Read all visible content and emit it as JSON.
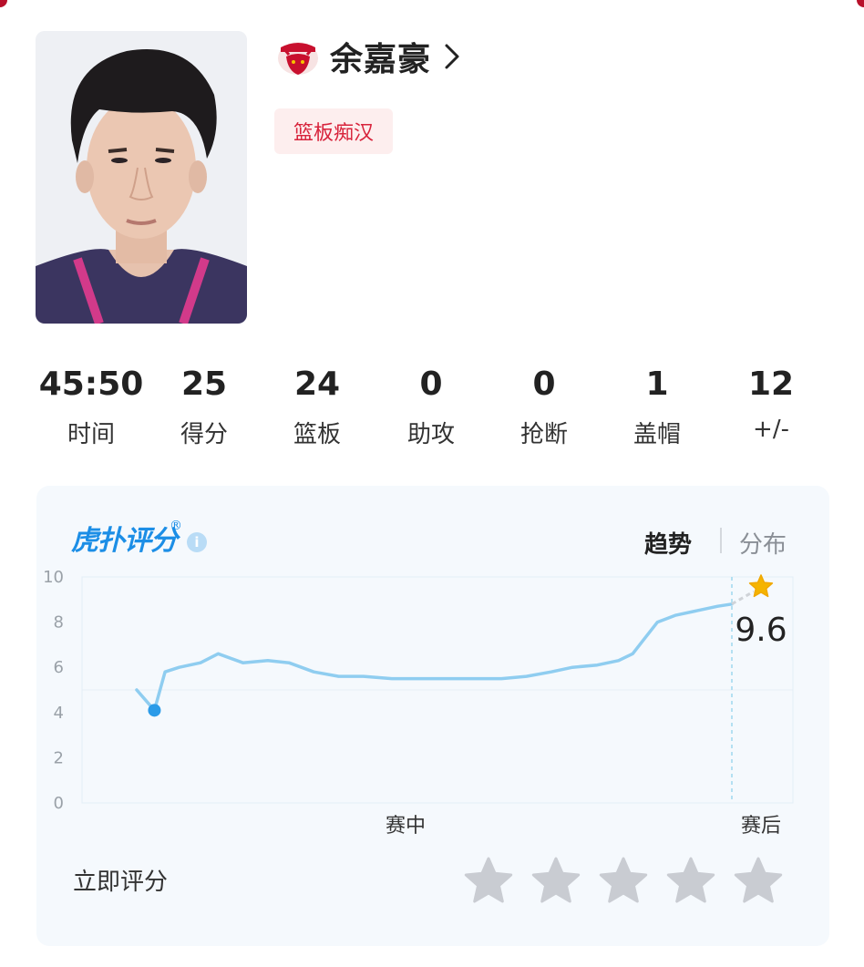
{
  "player": {
    "name": "余嘉豪",
    "tag": "篮板痴汉",
    "team_logo_text": "GOLDEN BULLS",
    "photo": "player-photo"
  },
  "stats": [
    {
      "value": "45:50",
      "label": "时间"
    },
    {
      "value": "25",
      "label": "得分"
    },
    {
      "value": "24",
      "label": "篮板"
    },
    {
      "value": "0",
      "label": "助攻"
    },
    {
      "value": "0",
      "label": "抢断"
    },
    {
      "value": "1",
      "label": "盖帽"
    },
    {
      "value": "12",
      "label": "+/-"
    }
  ],
  "rating": {
    "brand": "虎扑评分",
    "registered_mark": "®",
    "info_icon": "i",
    "tabs": {
      "active": "趋势",
      "inactive": "分布"
    },
    "score": "9.6",
    "rate_now_label": "立即评分",
    "stars_count": 5
  },
  "colors": {
    "accent_red": "#d8243c",
    "frame_red": "#b8102a",
    "chart_blue": "#8fcdf0",
    "brand_blue": "#1c8ee6",
    "star_gold": "#f5b400",
    "star_gray": "#c9ccd2"
  },
  "chart_data": {
    "type": "line",
    "ylim": [
      0,
      10
    ],
    "yticks": [
      "0",
      "2",
      "4",
      "6",
      "8",
      "10"
    ],
    "xticks": [
      "赛中",
      "赛后"
    ],
    "series": [
      {
        "points": [
          [
            0.0,
            5.0
          ],
          [
            0.05,
            4.1
          ],
          [
            0.08,
            5.8
          ],
          [
            0.12,
            6.0
          ],
          [
            0.18,
            6.2
          ],
          [
            0.23,
            6.6
          ],
          [
            0.3,
            6.2
          ],
          [
            0.37,
            6.3
          ],
          [
            0.43,
            6.2
          ],
          [
            0.5,
            5.8
          ],
          [
            0.57,
            5.6
          ],
          [
            0.64,
            5.6
          ],
          [
            0.72,
            5.5
          ],
          [
            0.8,
            5.5
          ],
          [
            0.87,
            5.5
          ],
          [
            0.95,
            5.5
          ],
          [
            1.03,
            5.5
          ],
          [
            1.1,
            5.6
          ],
          [
            1.17,
            5.8
          ],
          [
            1.23,
            6.0
          ],
          [
            1.3,
            6.1
          ],
          [
            1.36,
            6.3
          ],
          [
            1.4,
            6.6
          ],
          [
            1.43,
            7.2
          ],
          [
            1.47,
            8.0
          ],
          [
            1.52,
            8.3
          ],
          [
            1.58,
            8.5
          ],
          [
            1.64,
            8.7
          ],
          [
            1.68,
            8.8
          ]
        ],
        "min_marker": [
          0.05,
          4.1
        ]
      }
    ],
    "final_value": 9.6
  }
}
